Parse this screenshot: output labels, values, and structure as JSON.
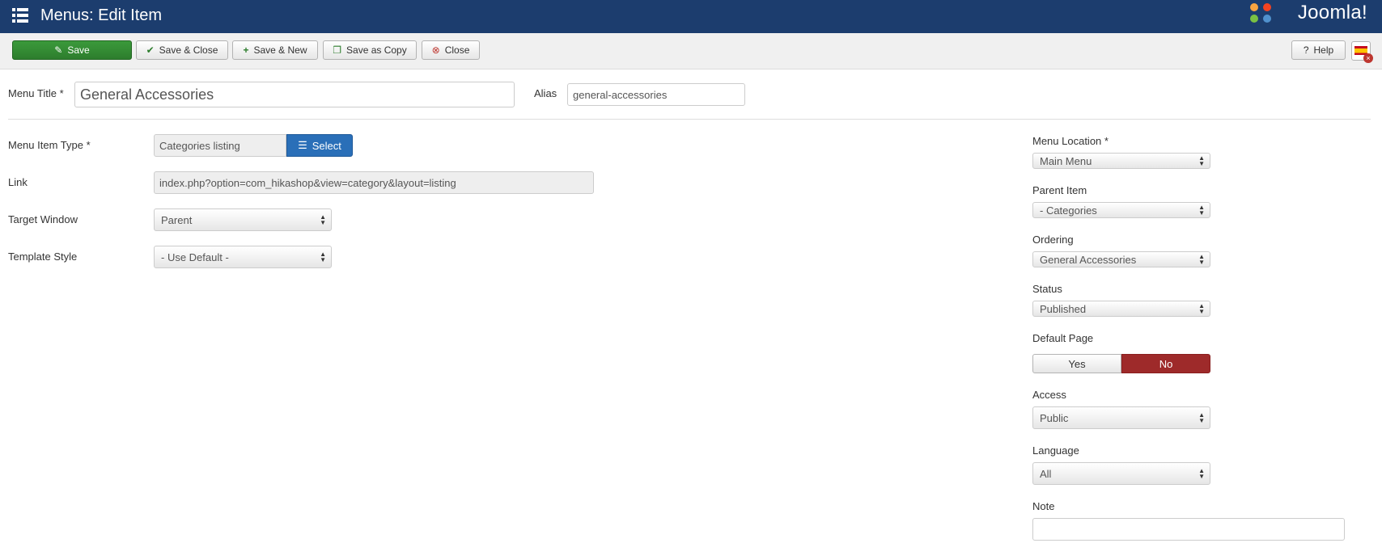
{
  "header": {
    "title": "Menus: Edit Item",
    "logo": "Joomla!"
  },
  "toolbar": {
    "save": "Save",
    "save_close": "Save & Close",
    "save_new": "Save & New",
    "save_copy": "Save as Copy",
    "close": "Close",
    "help": "Help"
  },
  "form": {
    "menu_title_label": "Menu Title *",
    "menu_title_value": "General Accessories",
    "alias_label": "Alias",
    "alias_value": "general-accessories",
    "item_type_label": "Menu Item Type *",
    "item_type_value": "Categories listing",
    "select_button": "Select",
    "link_label": "Link",
    "link_value": "index.php?option=com_hikashop&view=category&layout=listing",
    "target_label": "Target Window",
    "target_value": "Parent",
    "template_label": "Template Style",
    "template_value": "- Use Default -"
  },
  "side": {
    "location_label": "Menu Location *",
    "location_value": "Main Menu",
    "parent_label": "Parent Item",
    "parent_value": "- Categories",
    "ordering_label": "Ordering",
    "ordering_value": "General Accessories",
    "status_label": "Status",
    "status_value": "Published",
    "default_label": "Default Page",
    "default_yes": "Yes",
    "default_no": "No",
    "access_label": "Access",
    "access_value": "Public",
    "language_label": "Language",
    "language_value": "All",
    "note_label": "Note",
    "note_value": ""
  },
  "colors": {
    "header": "#1c3d6e",
    "save": "#2d7d2d",
    "select": "#2a6fb8",
    "no_active": "#9e2a2a"
  }
}
